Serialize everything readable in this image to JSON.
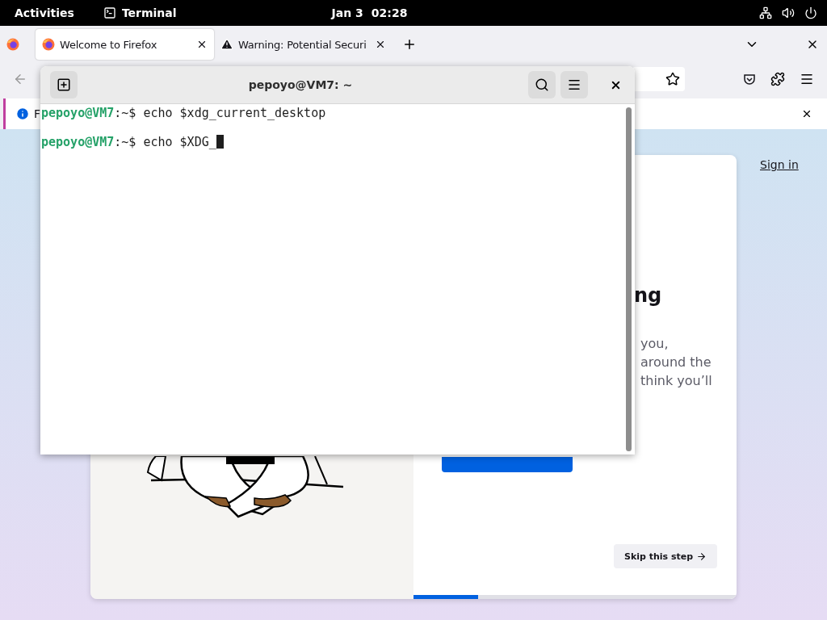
{
  "top_bar": {
    "activities": "Activities",
    "app": "Terminal",
    "date": "Jan 3",
    "time": "02:28"
  },
  "browser": {
    "tabs": [
      {
        "title": "Welcome to Firefox",
        "selected": true,
        "kind": "firefox"
      },
      {
        "title": "Warning: Potential Securi",
        "selected": false,
        "kind": "warning"
      }
    ],
    "notification": {
      "text": "F"
    },
    "page": {
      "sign_in": "Sign in",
      "heading": "ng",
      "paragraph_lines": [
        "you,",
        "around the",
        "think you’ll"
      ],
      "skip_button": "Skip this step",
      "progress": {
        "level": 0.2
      }
    }
  },
  "terminal": {
    "title": "pepoyo@VM7: ~",
    "lines": [
      {
        "user": "pepoyo@VM7",
        "prompt": ":~$",
        "command": "echo $xdg_current_desktop",
        "cursor": false
      },
      {
        "user": "pepoyo@VM7",
        "prompt": ":~$",
        "command": "echo $XDG_",
        "cursor": true
      }
    ]
  }
}
